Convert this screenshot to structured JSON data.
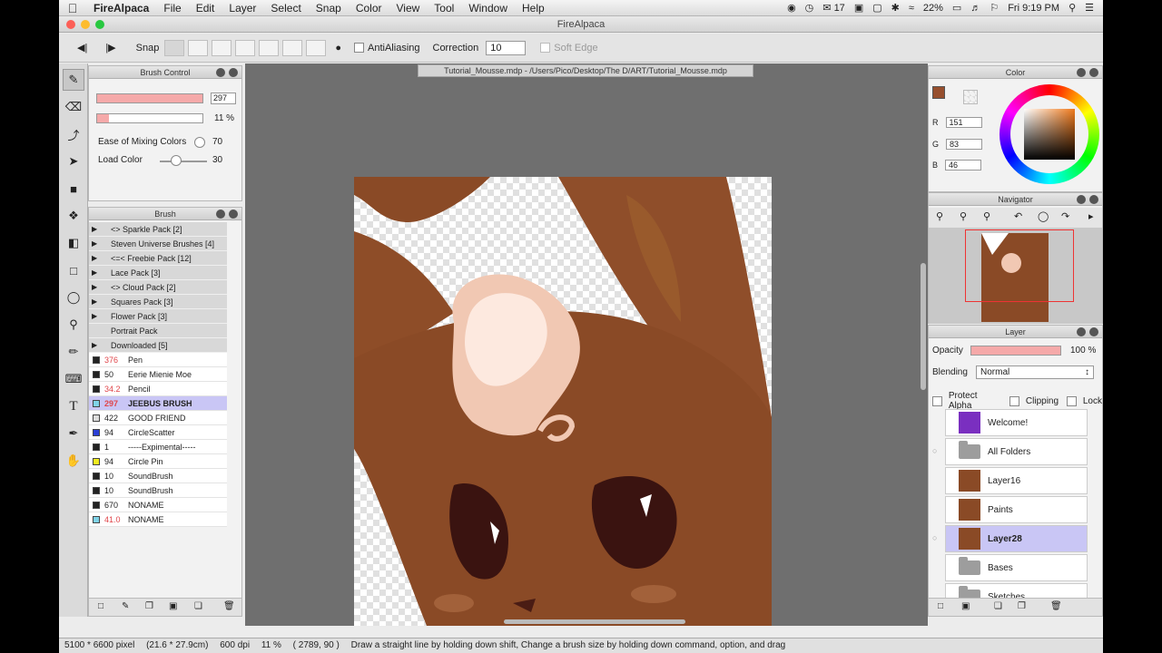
{
  "menubar": {
    "apple": "",
    "items": [
      "FireAlpaca",
      "File",
      "Edit",
      "Layer",
      "Select",
      "Snap",
      "Color",
      "View",
      "Tool",
      "Window",
      "Help"
    ],
    "status_num": "17",
    "battery": "22%",
    "clock": "Fri 9:19 PM"
  },
  "window": {
    "title": "FireAlpaca"
  },
  "toolbar": {
    "snap_label": "Snap",
    "antialiasing_label": "AntiAliasing",
    "correction_label": "Correction",
    "correction_value": "10",
    "soft_edge_label": "Soft Edge"
  },
  "brush_control": {
    "title": "Brush Control",
    "size_value": "297",
    "opacity_value": "11 %",
    "ease_label": "Ease of Mixing Colors",
    "ease_value": "70",
    "load_label": "Load Color",
    "load_value": "30"
  },
  "brush_panel": {
    "title": "Brush",
    "folders": [
      "<> Sparkle Pack [2]",
      "Steven Universe Brushes [4]",
      "<=< Freebie Pack [12]",
      "Lace Pack [3]",
      "<> Cloud Pack [2]",
      "Squares Pack [3]",
      "Flower Pack [3]",
      "Portrait Pack",
      "Downloaded [5]"
    ],
    "items": [
      {
        "size": "376",
        "name": "Pen",
        "color": "#222222",
        "size_color": "#e0454a"
      },
      {
        "size": "50",
        "name": "Eerie Mienie Moe",
        "color": "#222222",
        "size_color": "#222222"
      },
      {
        "size": "34.2",
        "name": "Pencil",
        "color": "#222222",
        "size_color": "#e0454a"
      },
      {
        "size": "297",
        "name": "JEEBUS BRUSH",
        "color": "#7fd3e8",
        "size_color": "#e0454a"
      },
      {
        "size": "422",
        "name": "GOOD FRIEND",
        "color": "#dddddd",
        "size_color": "#222222"
      },
      {
        "size": "94",
        "name": "CircleScatter",
        "color": "#2b3fd6",
        "size_color": "#222222"
      },
      {
        "size": "1",
        "name": "-----Expimental-----",
        "color": "#222222",
        "size_color": "#222222"
      },
      {
        "size": "94",
        "name": "Circle Pin",
        "color": "#f1ec1e",
        "size_color": "#222222"
      },
      {
        "size": "10",
        "name": "SoundBrush",
        "color": "#222222",
        "size_color": "#222222"
      },
      {
        "size": "10",
        "name": "SoundBrush",
        "color": "#222222",
        "size_color": "#222222"
      },
      {
        "size": "670",
        "name": "NONAME",
        "color": "#222222",
        "size_color": "#222222"
      },
      {
        "size": "41.0",
        "name": "NONAME",
        "color": "#7fd3e8",
        "size_color": "#e0454a"
      }
    ]
  },
  "document": {
    "tab": "Tutorial_Mousse.mdp - /Users/Pico/Desktop/The D/ART/Tutorial_Mousse.mdp"
  },
  "color_panel": {
    "title": "Color",
    "r_label": "R",
    "r": "151",
    "g_label": "G",
    "g": "83",
    "b_label": "B",
    "b": "46",
    "primary_color": "#974f2e",
    "secondary_color": "#7a2fc0"
  },
  "navigator": {
    "title": "Navigator"
  },
  "layer_panel": {
    "title": "Layer",
    "opacity_label": "Opacity",
    "opacity_value": "100 %",
    "blending_label": "Blending",
    "blending_value": "Normal",
    "protect_alpha": "Protect Alpha",
    "clipping": "Clipping",
    "lock": "Lock",
    "layers": [
      {
        "name": "Welcome!",
        "kind": "image"
      },
      {
        "name": "All Folders",
        "kind": "folder"
      },
      {
        "name": "Layer16",
        "kind": "image"
      },
      {
        "name": "Paints",
        "kind": "image"
      },
      {
        "name": "Layer28",
        "kind": "image"
      },
      {
        "name": "Bases",
        "kind": "folder"
      },
      {
        "name": "Sketches",
        "kind": "folder"
      }
    ]
  },
  "statusbar": {
    "pixels": "5100 * 6600 pixel",
    "cm": "(21.6 * 27.9cm)",
    "dpi": "600 dpi",
    "zoom": "11 %",
    "coords": "( 2789, 90 )",
    "hint": "Draw a straight line by holding down shift, Change a brush size by holding down command, option, and drag"
  }
}
